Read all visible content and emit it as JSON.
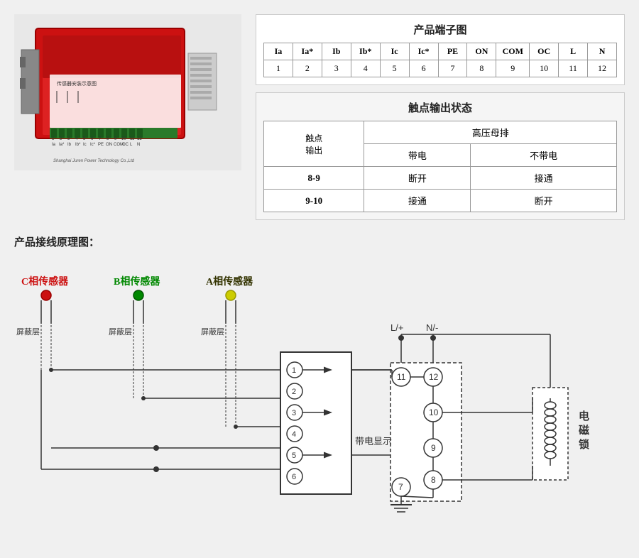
{
  "top": {
    "terminal_diagram": {
      "title": "产品端子图",
      "headers": [
        "Ia",
        "Ia*",
        "Ib",
        "Ib*",
        "Ic",
        "Ic*",
        "PE",
        "ON",
        "COM",
        "OC",
        "L",
        "N"
      ],
      "values": [
        "1",
        "2",
        "3",
        "4",
        "5",
        "6",
        "7",
        "8",
        "9",
        "10",
        "11",
        "12"
      ]
    },
    "contact_output": {
      "title": "触点输出状态",
      "col_header1": "高压母排",
      "col_header2": "带电",
      "col_header3": "不带电",
      "row_header": "触点\n输出",
      "rows": [
        {
          "id": "8-9",
          "powered": "断开",
          "unpowered": "接通"
        },
        {
          "id": "9-10",
          "powered": "接通",
          "unpowered": "断开"
        }
      ]
    }
  },
  "bottom": {
    "title": "产品接线原理图：",
    "sensors": [
      {
        "label": "C相传感器",
        "color": "#cc0000"
      },
      {
        "label": "B相传感器",
        "color": "#008800"
      },
      {
        "label": "A相传感器",
        "color": "#cccc00"
      }
    ],
    "shield_label": "屏蔽层",
    "terminals": [
      "1",
      "2",
      "3",
      "4",
      "5",
      "6"
    ],
    "power_labels": [
      "L/+",
      "N/-"
    ],
    "right_terminals": [
      "11",
      "12",
      "10",
      "9",
      "8",
      "7"
    ],
    "display_label": "带电显示",
    "lock_label": "电磁锁",
    "ground_symbol": "⏚"
  }
}
